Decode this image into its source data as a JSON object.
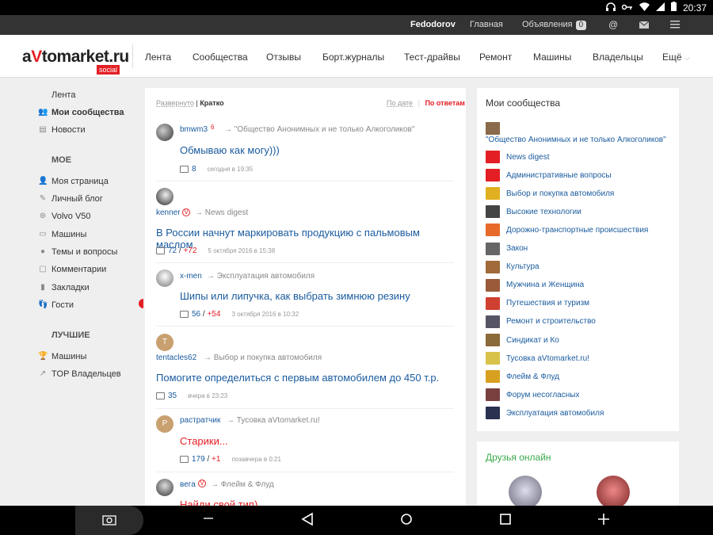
{
  "statusbar": {
    "time": "20:37",
    "icons": [
      "headphones-icon",
      "key-icon",
      "wifi-icon",
      "signal-icon",
      "battery-icon"
    ]
  },
  "topbar": {
    "user": "Fedodorov",
    "home": "Главная",
    "ads": "Объявления",
    "ads_count": "0",
    "at": "@",
    "mail_icon": "mail-icon",
    "menu_icon": "hamburger-icon"
  },
  "header": {
    "logo_a": "a",
    "logo_v": "V",
    "logo_rest": "tomarket.ru",
    "logo_social": "social",
    "nav": [
      "Лента",
      "Сообщества",
      "Отзывы",
      "Борт.журналы",
      "Тест-драйвы",
      "Ремонт",
      "Машины",
      "Владельцы",
      "Ещё"
    ]
  },
  "sidebar": {
    "top": [
      "Лента",
      "Мои сообщества",
      "Новости"
    ],
    "moe_head": "МОЕ",
    "moe": [
      "Моя страница",
      "Личный блог",
      "Volvo V50",
      "Машины",
      "Темы и вопросы",
      "Комментарии",
      "Закладки",
      "Гости"
    ],
    "best_head": "ЛУЧШИЕ",
    "best": [
      "Машины",
      "TOP Владельцев"
    ]
  },
  "feed": {
    "tab_expanded": "Развернуто",
    "tab_sep": "|",
    "tab_brief": "Кратко",
    "sort_date": "По дате",
    "sort_replies": "По ответам",
    "posts": [
      {
        "author": "bmwm3",
        "badge": "6",
        "arrow": "→",
        "community": "\"Общество Анонимных и не только Алкоголиков\"",
        "title": "Обмываю как могу)))",
        "comments": "8",
        "plus": "",
        "time": "сегодня в 19:35"
      },
      {
        "author": "kenner",
        "badge": "V",
        "arrow": "→",
        "community": "News digest",
        "title": "В России начнут маркировать продукцию с пальмовым маслом",
        "comments": "72",
        "sep": "/",
        "plus": "+72",
        "time": "5 октября 2016 в 15:38"
      },
      {
        "author": "x-men",
        "badge": "",
        "arrow": "→",
        "community": "Эксплуатация автомобиля",
        "title": "Шипы или липучка, как выбрать зимнюю резину",
        "comments": "56",
        "sep": "/",
        "plus": "+54",
        "time": "3 октября 2016 в 10:32"
      },
      {
        "author": "tentacles62",
        "badge": "",
        "arrow": "→",
        "community": "Выбор и покупка автомобиля",
        "title": "Помогите определиться с первым автомобилем до 450 т.р.",
        "comments": "35",
        "plus": "",
        "time": "вчера в 23:23",
        "avatar_letter": "T"
      },
      {
        "author": "растратчик",
        "badge": "",
        "arrow": "→",
        "community": "Тусовка aVtomarket.ru!",
        "title": "Старики...",
        "comments": "179",
        "sep": "/",
        "plus": "+1",
        "time": "позавчера в 0:21",
        "avatar_letter": "Р"
      },
      {
        "author": "вега",
        "badge": "V",
        "arrow": "→",
        "community": "Флейм & Флуд",
        "title": "Найди свой тип)",
        "comments": "",
        "plus": "",
        "time": ""
      }
    ]
  },
  "my_communities": {
    "title": "Мои сообщества",
    "items": [
      "\"Общество Анонимных и не только Алкоголиков\"",
      "News digest",
      "Административные вопросы",
      "Выбор и покупка автомобиля",
      "Высокие технологии",
      "Дорожно-транспортные происшествия",
      "Закон",
      "Культура",
      "Мужчина и Женщина",
      "Путешествия и туризм",
      "Ремонт и строительство",
      "Синдикат и Ко",
      "Тусовка aVtomarket.ru!",
      "Флейм & Флуд",
      "Форум несогласных",
      "Эксплуатация автомобиля"
    ],
    "icon_colors": [
      "#8a6a4a",
      "#e31e24",
      "#e31e24",
      "#e0b020",
      "#444",
      "#e86a2a",
      "#666",
      "#a06a3a",
      "#9a5a3a",
      "#d04030",
      "#556",
      "#8a6a3a",
      "#d9c24a",
      "#d8a020",
      "#7a4040",
      "#2a3050"
    ]
  },
  "friends": {
    "title": "Друзья онлайн"
  }
}
